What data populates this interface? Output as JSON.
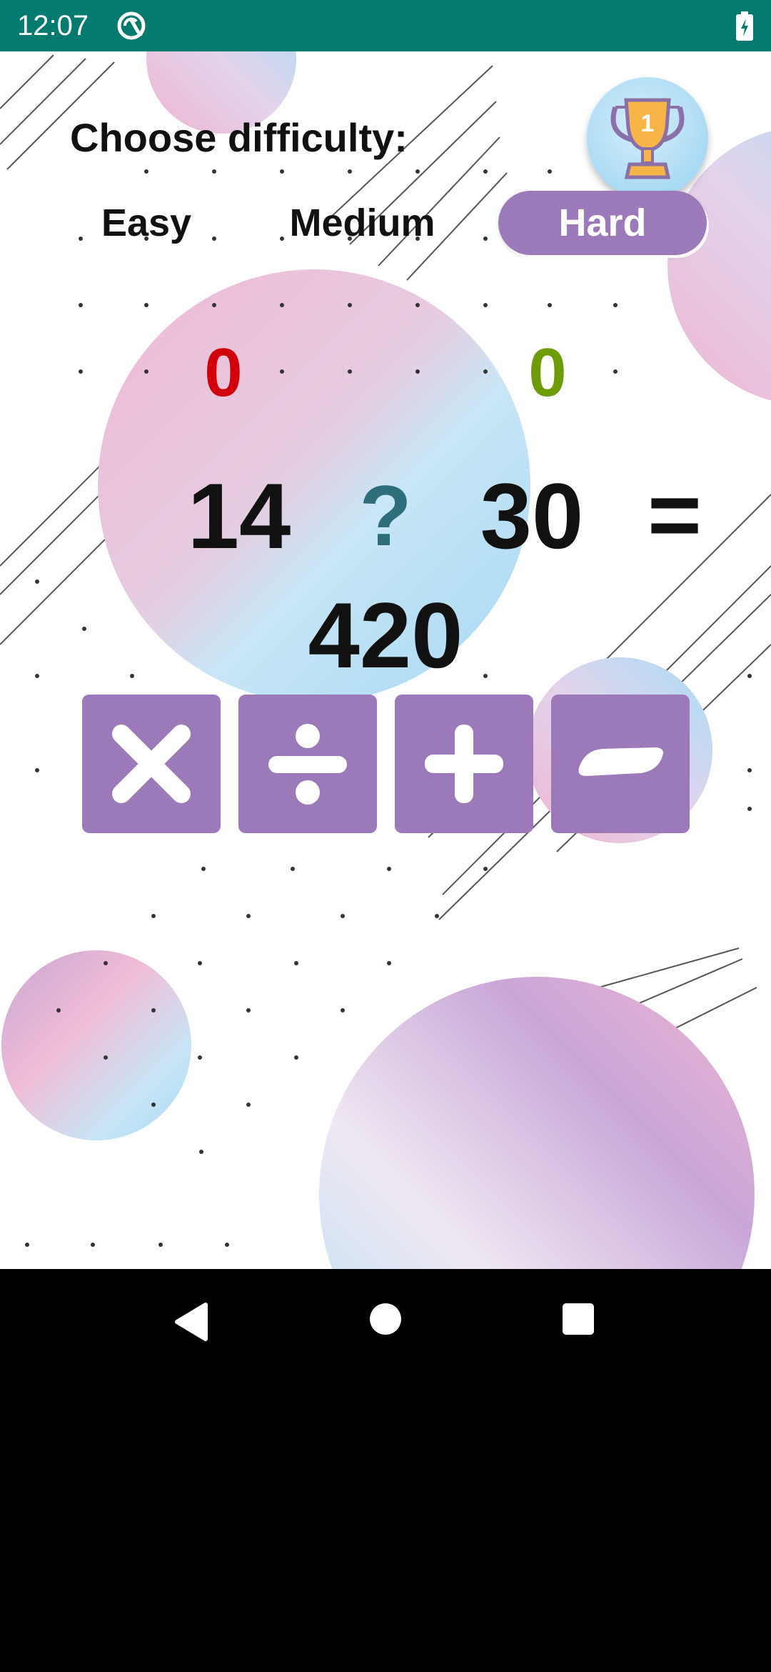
{
  "status_bar": {
    "time": "12:07",
    "app_icon": "sync-circle-icon",
    "battery_icon": "battery-charging-icon",
    "color": "#057A6E"
  },
  "header": {
    "title": "Choose difficulty:"
  },
  "leaderboard": {
    "icon": "trophy-icon",
    "rank": "1"
  },
  "difficulty": {
    "options": [
      "Easy",
      "Medium",
      "Hard"
    ],
    "selected": "Hard",
    "selected_color": "#9C79B8"
  },
  "score": {
    "wrong": "0",
    "right": "0",
    "wrong_color": "#D10008",
    "right_color": "#6E9B08"
  },
  "equation": {
    "left_operand": "14",
    "operator_placeholder": "?",
    "right_operand": "30",
    "equals": "=",
    "result": "420"
  },
  "operators": [
    {
      "name": "multiply",
      "icon": "multiply-icon"
    },
    {
      "name": "divide",
      "icon": "divide-icon"
    },
    {
      "name": "plus",
      "icon": "plus-icon"
    },
    {
      "name": "minus",
      "icon": "minus-icon"
    }
  ],
  "operator_button_color": "#9C79B8",
  "nav_bar": {
    "icons": [
      "back-icon",
      "home-icon",
      "recents-icon"
    ]
  }
}
